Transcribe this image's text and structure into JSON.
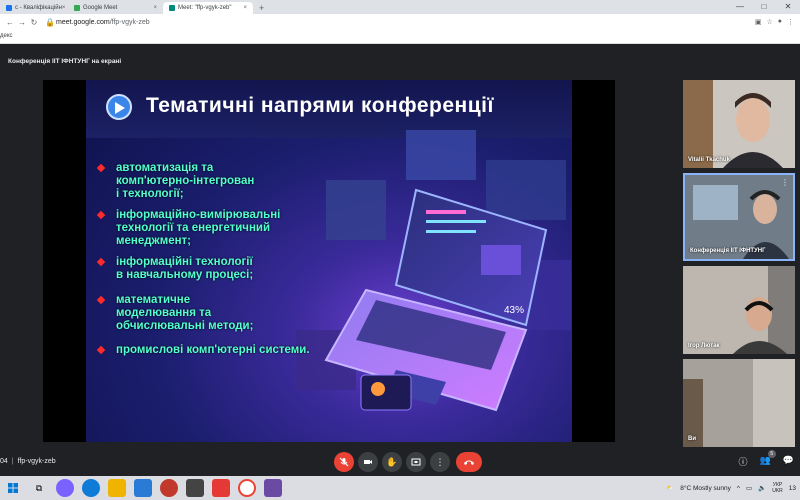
{
  "browser": {
    "tabs": [
      {
        "label": "c - Кваліфікаційн",
        "favicon_color": "#1a73e8"
      },
      {
        "label": "Google Meet",
        "favicon_color": "#34a853"
      },
      {
        "label": "Meet: \"ffp-vgyk-zeb\"",
        "favicon_color": "#00897b"
      }
    ],
    "tab_close": "×",
    "new_tab": "+",
    "window_controls": [
      "—",
      "□",
      "✕"
    ],
    "url_domain": "meet.google.com",
    "url_path": "/ffp-vgyk-zeb",
    "bookmarks_text": "декс",
    "nav": [
      "←",
      "→",
      "↻"
    ]
  },
  "meet": {
    "presenting_label": "Конференція ІІТ ІФНТУНГ на екрані",
    "slide": {
      "title": "Тематичні напрями конференції",
      "bullets": [
        [
          "автоматизація та",
          "комп'ютерно-інтегрован",
          "і технології;"
        ],
        [
          "інформаційно-вимірювальні",
          "технології та енергетичний",
          "менеджмент;"
        ],
        [
          "інформаційні технології",
          "в навчальному процесі;"
        ],
        [
          "математичне",
          "моделювання та",
          "обчислювальні методи;"
        ],
        [
          "промислові комп'ютерні системи."
        ]
      ],
      "laptop_percent": "43%"
    },
    "participants": [
      {
        "name": "Vitalii Tkachuk"
      },
      {
        "name": "Конференція ІІТ ІФНТУНГ"
      },
      {
        "name": "Ігор Лютак"
      },
      {
        "name": "Ви"
      }
    ],
    "meeting_time": "04",
    "meeting_code": "ffp-vgyk-zeb",
    "participant_count": "5",
    "controls": {
      "mic": "mic-off",
      "camera": "camera",
      "hand": "raise-hand",
      "present": "present",
      "hangup": "hang-up"
    }
  },
  "taskbar": {
    "weather": "8°C  Mostly sunny",
    "lang_top": "УКР",
    "lang_bottom": "UKR",
    "time": "13"
  }
}
